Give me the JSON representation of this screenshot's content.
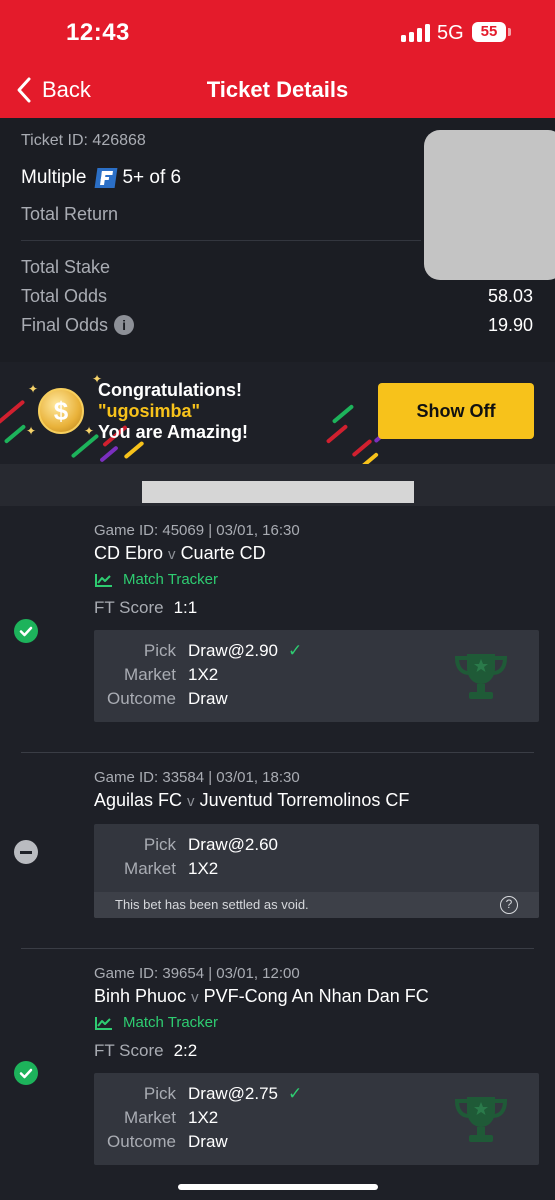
{
  "status_bar": {
    "time": "12:43",
    "network": "5G",
    "battery": "55"
  },
  "nav": {
    "back_label": "Back",
    "title": "Ticket Details"
  },
  "summary": {
    "ticket_id": "Ticket ID: 426868",
    "bet_type": "Multiple",
    "combo": "5+ of 6",
    "total_return_label": "Total Return",
    "total_stake_label": "Total Stake",
    "total_odds_label": "Total Odds",
    "total_odds_value": "58.03",
    "final_odds_label": "Final Odds",
    "final_odds_value": "19.90"
  },
  "banner": {
    "line1": "Congratulations!",
    "user": "\"ugosimba\"",
    "line3": "You are Amazing!",
    "button": "Show Off"
  },
  "games": [
    {
      "game_id": "Game ID: 45069 | 03/01, 16:30",
      "home": "CD Ebro",
      "away": "Cuarte CD",
      "vs": "v",
      "tracker": "Match Tracker",
      "ft_label": "FT Score",
      "ft_score": "1:1",
      "pick_label": "Pick",
      "pick": "Draw@2.90",
      "market_label": "Market",
      "market": "1X2",
      "outcome_label": "Outcome",
      "outcome": "Draw",
      "status": "won"
    },
    {
      "game_id": "Game ID: 33584 | 03/01, 18:30",
      "home": "Aguilas FC",
      "away": "Juventud Torremolinos CF",
      "vs": "v",
      "pick_label": "Pick",
      "pick": "Draw@2.60",
      "market_label": "Market",
      "market": "1X2",
      "void_note": "This bet has been settled as void.",
      "status": "void"
    },
    {
      "game_id": "Game ID: 39654 | 03/01, 12:00",
      "home": "Binh Phuoc",
      "away": "PVF-Cong An Nhan Dan FC",
      "vs": "v",
      "tracker": "Match Tracker",
      "ft_label": "FT Score",
      "ft_score": "2:2",
      "pick_label": "Pick",
      "pick": "Draw@2.75",
      "market_label": "Market",
      "market": "1X2",
      "outcome_label": "Outcome",
      "outcome": "Draw",
      "status": "won"
    }
  ],
  "icons": {
    "back": "chevron-left-icon",
    "info": "info-icon",
    "coin": "coin-icon",
    "tracker": "chart-line-icon",
    "check": "check-icon",
    "trophy": "trophy-icon",
    "help": "question-icon"
  },
  "colors": {
    "brand_red": "#e41b2b",
    "accent_yellow": "#f7c21b",
    "success_green": "#2ecc71",
    "background": "#1e2027"
  }
}
